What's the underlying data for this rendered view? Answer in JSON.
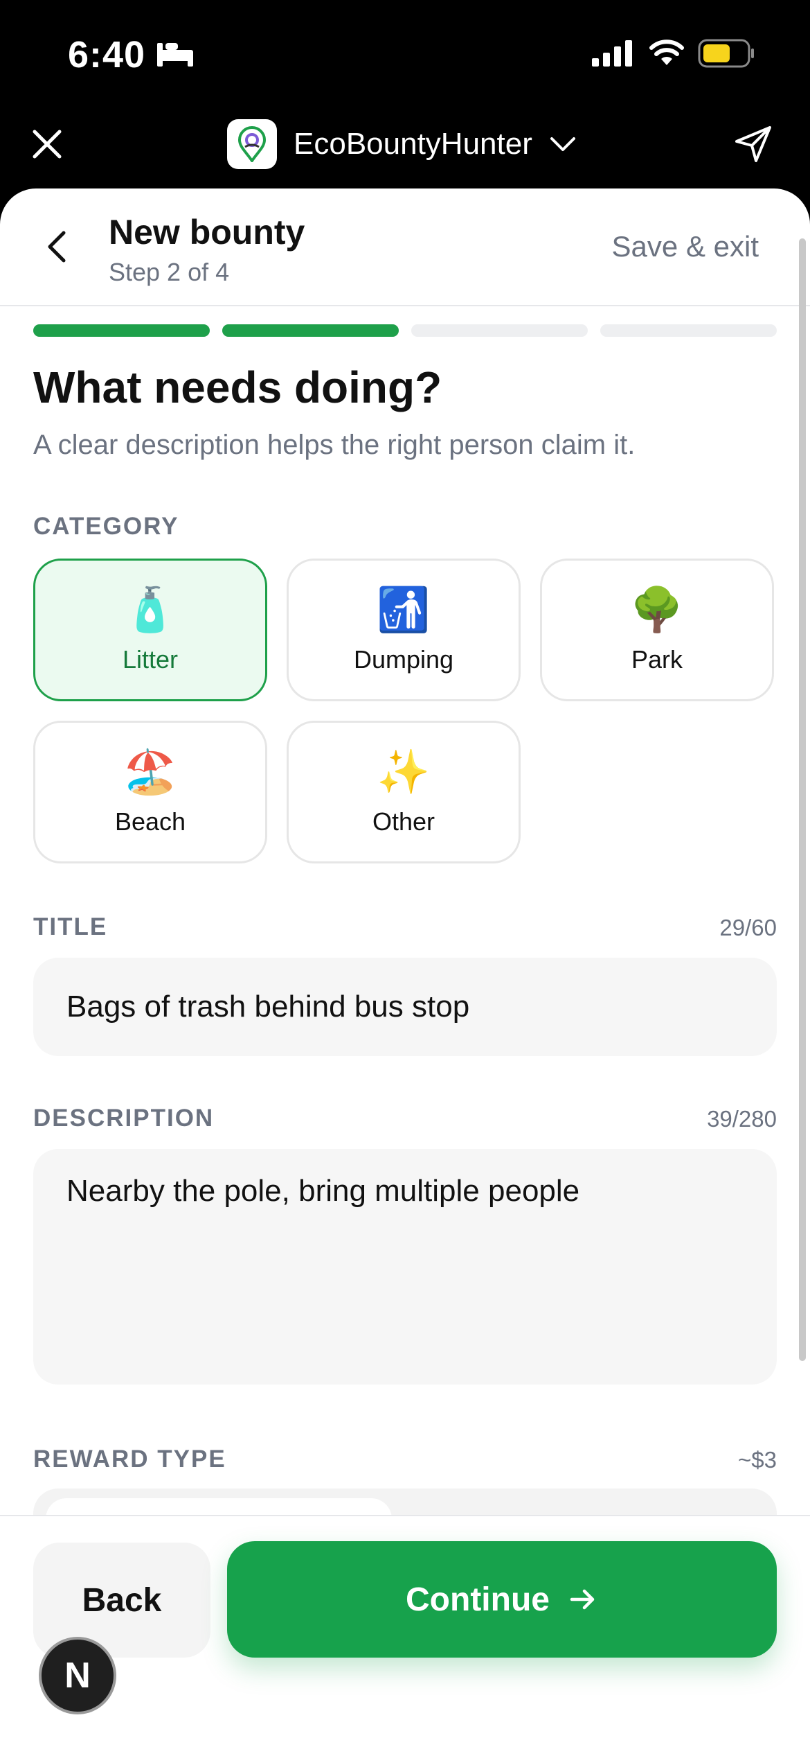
{
  "status_bar": {
    "time": "6:40"
  },
  "app_bar": {
    "app_name": "EcoBountyHunter"
  },
  "header": {
    "title": "New bounty",
    "step": "Step 2 of 4",
    "save_exit": "Save & exit"
  },
  "progress": {
    "current_step": 2,
    "total_steps": 4
  },
  "content": {
    "title": "What needs doing?",
    "subtitle": "A clear description helps the right person claim it."
  },
  "category": {
    "label": "CATEGORY",
    "items": [
      {
        "emoji": "🧴",
        "label": "Litter",
        "selected": true
      },
      {
        "emoji": "🚮",
        "label": "Dumping",
        "selected": false
      },
      {
        "emoji": "🌳",
        "label": "Park",
        "selected": false
      },
      {
        "emoji": "🏖️",
        "label": "Beach",
        "selected": false
      },
      {
        "emoji": "✨",
        "label": "Other",
        "selected": false
      }
    ]
  },
  "title_field": {
    "label": "TITLE",
    "counter": "29/60",
    "value": "Bags of trash behind bus stop"
  },
  "description_field": {
    "label": "DESCRIPTION",
    "counter": "39/280",
    "value": "Nearby the pole, bring multiple people"
  },
  "reward": {
    "label": "REWARD TYPE",
    "estimate": "~$3"
  },
  "footer": {
    "back_label": "Back",
    "continue_label": "Continue",
    "badge_letter": "N"
  },
  "colors": {
    "accent": "#17a24c",
    "accent_light": "#ebfaf0",
    "muted": "#6b7280"
  }
}
